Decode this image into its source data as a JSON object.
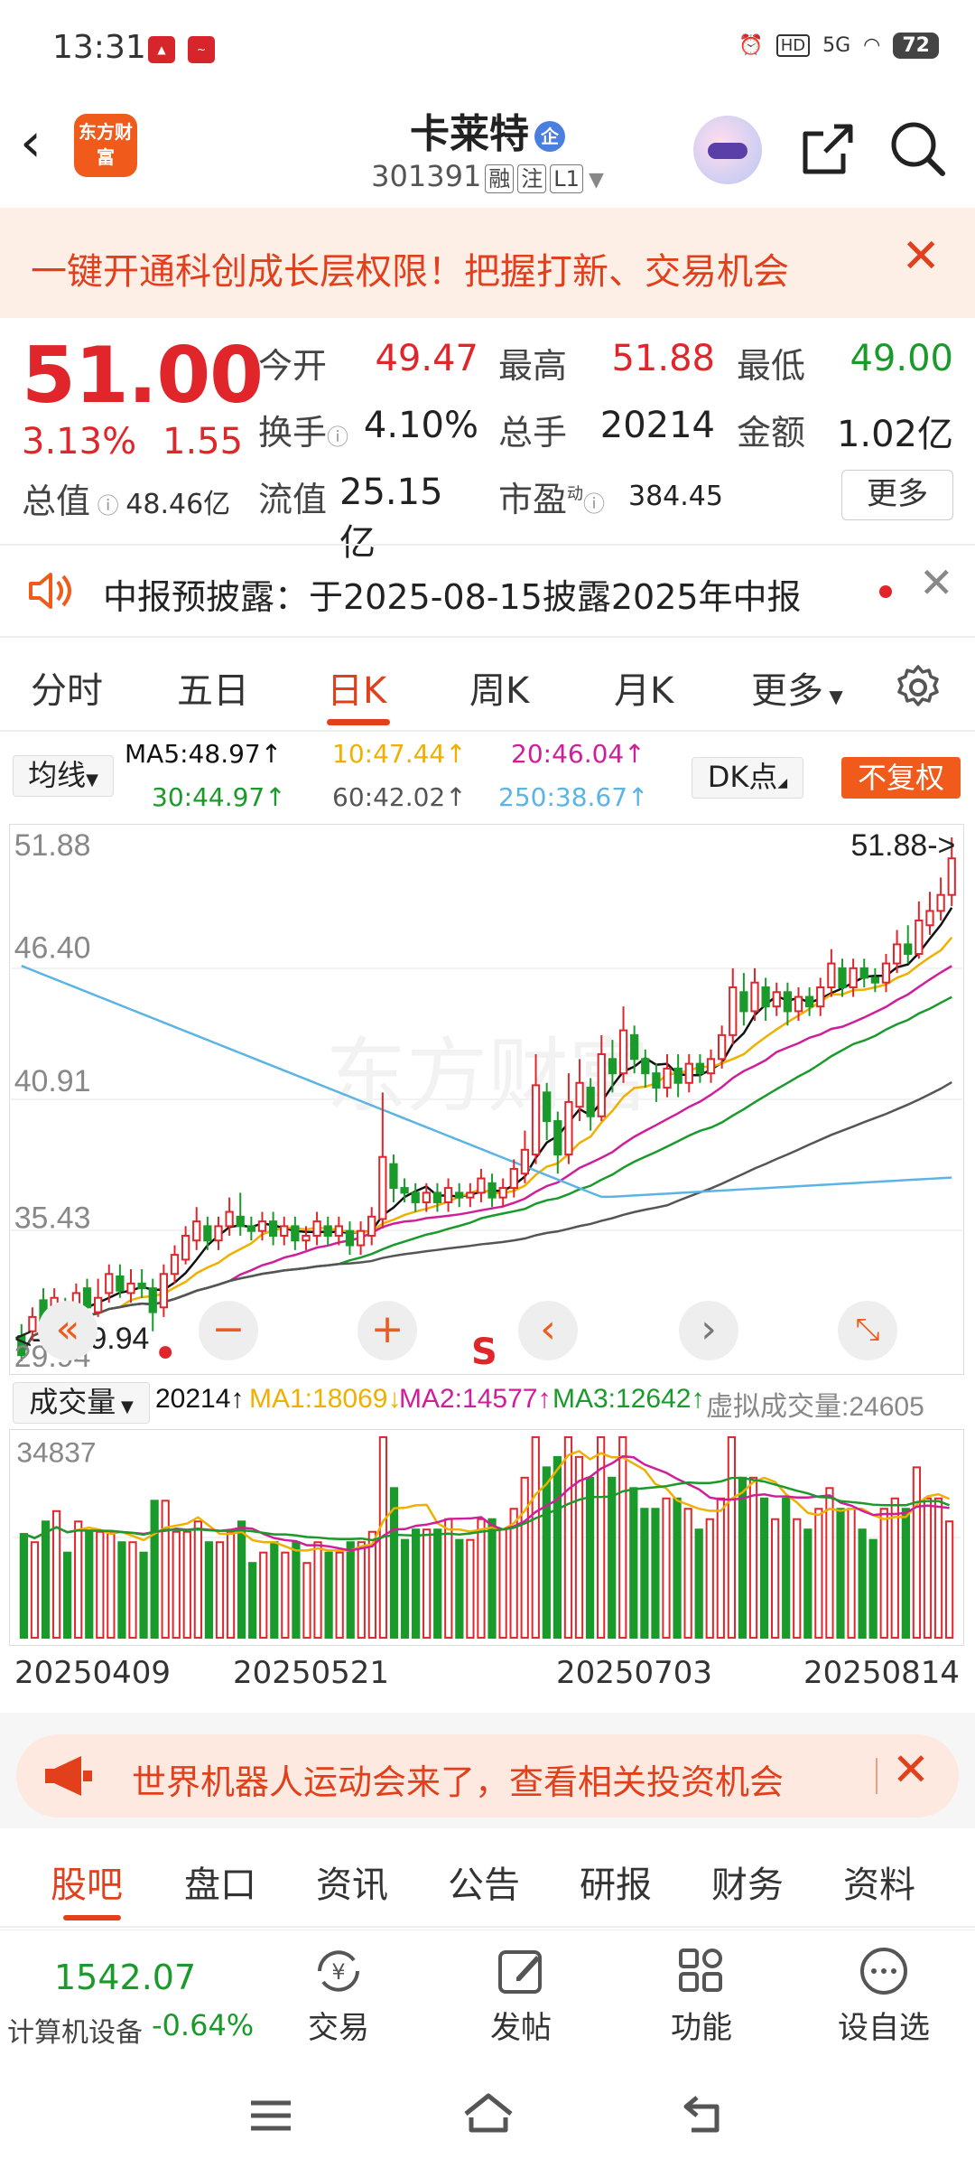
{
  "status": {
    "time": "13:31",
    "network": "5G",
    "battery": "72"
  },
  "header": {
    "stock_name": "卡莱特",
    "zheng_badge": "企",
    "code": "301391",
    "tags": [
      "融",
      "注",
      "L1"
    ],
    "logo_text": "东方财富"
  },
  "banner_top": {
    "text": "一键开通科创成长层权限！把握打新、交易机会",
    "close": "✕"
  },
  "quote": {
    "price": "51.00",
    "change_pct": "3.13%",
    "change": "1.55",
    "total_value_label": "总值",
    "total_value": "48.46亿",
    "open_label": "今开",
    "open": "49.47",
    "high_label": "最高",
    "high": "51.88",
    "low_label": "最低",
    "low": "49.00",
    "turnover_label": "换手",
    "turnover": "4.10%",
    "volume_label": "总手",
    "volume": "20214",
    "amount_label": "金额",
    "amount": "1.02亿",
    "float_label": "流值",
    "float_value": "25.15亿",
    "pe_label": "市盈",
    "pe_sup": "动",
    "pe": "384.45",
    "more": "更多"
  },
  "notice": {
    "text": "中报预披露：于2025-08-15披露2025年中报"
  },
  "tabs": [
    "分时",
    "五日",
    "日K",
    "周K",
    "月K",
    "更多"
  ],
  "active_tab": "日K",
  "ma_bar": {
    "selector": "均线",
    "dk": "DK点",
    "fuquan": "不复权",
    "ma5": "MA5:48.97↑",
    "ma10": "10:47.44↑",
    "ma20": "20:46.04↑",
    "ma30": "30:44.97↑",
    "ma60": "60:42.02↑",
    "ma250": "250:38.67↑"
  },
  "colors": {
    "up": "#e0252b",
    "down": "#1a9a2a",
    "accent": "#e2401c",
    "ma5": "#111111",
    "ma10": "#f0b000",
    "ma20": "#d01e9a",
    "ma30": "#1a9a2a",
    "ma60": "#555555",
    "ma250": "#5ab4e6"
  },
  "kline_labels": {
    "y_top": "51.88",
    "y2": "46.40",
    "y3": "40.91",
    "y4": "35.43",
    "y_bottom": "29.94",
    "max_marker": "51.88->",
    "min_marker": "<----29.94",
    "s_badge": "S"
  },
  "volume_bar": {
    "selector": "成交量",
    "vol": "20214↑",
    "ma1": "MA1:18069↓",
    "ma2": "MA2:14577↑",
    "ma3": "MA3:12642↑",
    "virtual": "虚拟成交量:24605",
    "y_max": "34837"
  },
  "dates": [
    "20250409",
    "20250521",
    "20250703",
    "20250814"
  ],
  "chart_data": {
    "type": "candlestick",
    "ylim": [
      29.94,
      51.88
    ],
    "volume_max": 34837,
    "candles_approx": [
      [
        31.0,
        30.2,
        31.5,
        29.94
      ],
      [
        31.2,
        31.8,
        32.2,
        30.8
      ],
      [
        32.5,
        31.6,
        33.0,
        31.2
      ],
      [
        31.4,
        32.6,
        33.0,
        31.0
      ],
      [
        32.0,
        31.8,
        32.6,
        31.4
      ],
      [
        31.6,
        32.8,
        33.2,
        31.4
      ],
      [
        33.0,
        32.2,
        33.4,
        31.8
      ],
      [
        32.0,
        32.6,
        33.4,
        31.8
      ],
      [
        32.8,
        33.6,
        34.0,
        32.4
      ],
      [
        33.5,
        32.9,
        34.0,
        32.6
      ],
      [
        32.8,
        33.2,
        33.8,
        32.4
      ],
      [
        33.2,
        33.0,
        33.8,
        32.6
      ],
      [
        33.0,
        32.0,
        33.4,
        31.2
      ],
      [
        32.2,
        33.6,
        34.0,
        31.8
      ],
      [
        33.6,
        34.4,
        34.8,
        33.2
      ],
      [
        34.2,
        35.2,
        35.6,
        34.0
      ],
      [
        35.0,
        35.8,
        36.4,
        34.6
      ],
      [
        35.6,
        35.0,
        36.0,
        34.6
      ],
      [
        35.0,
        35.6,
        36.0,
        34.6
      ],
      [
        35.6,
        36.2,
        36.8,
        35.2
      ],
      [
        36.0,
        35.6,
        37.0,
        35.2
      ],
      [
        35.6,
        35.4,
        36.0,
        35.0
      ],
      [
        35.4,
        35.8,
        36.2,
        35.0
      ],
      [
        35.8,
        35.2,
        36.2,
        34.8
      ],
      [
        35.2,
        35.6,
        36.0,
        34.8
      ],
      [
        35.6,
        35.0,
        36.0,
        34.6
      ],
      [
        35.0,
        35.2,
        35.6,
        34.6
      ],
      [
        35.2,
        35.8,
        36.2,
        34.8
      ],
      [
        35.6,
        35.2,
        36.0,
        34.8
      ],
      [
        35.2,
        35.6,
        36.0,
        34.8
      ],
      [
        35.4,
        34.8,
        35.8,
        34.4
      ],
      [
        34.8,
        35.4,
        35.8,
        34.4
      ],
      [
        35.2,
        36.0,
        36.4,
        34.8
      ],
      [
        35.9,
        38.5,
        41.2,
        35.5
      ],
      [
        38.2,
        37.2,
        38.6,
        36.6
      ],
      [
        37.2,
        37.0,
        37.6,
        36.6
      ],
      [
        37.0,
        36.6,
        37.4,
        36.2
      ],
      [
        36.6,
        37.0,
        37.4,
        36.2
      ],
      [
        37.0,
        36.6,
        37.4,
        36.2
      ],
      [
        36.6,
        37.2,
        37.6,
        36.2
      ],
      [
        37.0,
        36.8,
        37.4,
        36.4
      ],
      [
        36.8,
        37.0,
        37.4,
        36.4
      ],
      [
        37.0,
        37.6,
        38.0,
        36.6
      ],
      [
        37.4,
        36.8,
        37.8,
        36.4
      ],
      [
        36.8,
        37.2,
        37.6,
        36.4
      ],
      [
        37.2,
        38.0,
        38.4,
        36.8
      ],
      [
        37.8,
        38.8,
        39.6,
        37.4
      ],
      [
        38.6,
        41.5,
        42.8,
        38.2
      ],
      [
        41.2,
        40.0,
        41.6,
        39.2
      ],
      [
        40.0,
        38.6,
        40.4,
        37.8
      ],
      [
        38.6,
        40.8,
        42.0,
        38.2
      ],
      [
        40.6,
        41.6,
        42.6,
        40.0
      ],
      [
        41.4,
        40.2,
        41.8,
        39.6
      ],
      [
        40.2,
        42.8,
        43.6,
        40.0
      ],
      [
        42.6,
        42.0,
        43.4,
        41.2
      ],
      [
        42.0,
        43.8,
        44.8,
        41.6
      ],
      [
        43.6,
        42.6,
        44.0,
        42.0
      ],
      [
        42.6,
        42.0,
        43.0,
        41.4
      ],
      [
        42.0,
        41.4,
        42.4,
        40.8
      ],
      [
        41.4,
        42.2,
        42.8,
        41.0
      ],
      [
        42.2,
        41.6,
        42.8,
        41.0
      ],
      [
        41.6,
        42.4,
        42.8,
        41.2
      ],
      [
        42.4,
        42.0,
        42.8,
        41.6
      ],
      [
        42.0,
        42.6,
        43.0,
        41.6
      ],
      [
        42.6,
        43.6,
        44.0,
        42.2
      ],
      [
        43.6,
        45.6,
        46.4,
        43.2
      ],
      [
        45.4,
        44.6,
        46.2,
        44.0
      ],
      [
        44.6,
        45.8,
        46.4,
        44.2
      ],
      [
        45.6,
        44.8,
        46.0,
        44.2
      ],
      [
        44.8,
        45.4,
        45.8,
        44.4
      ],
      [
        45.4,
        44.6,
        45.8,
        44.0
      ],
      [
        44.6,
        45.2,
        45.6,
        44.2
      ],
      [
        45.2,
        44.8,
        45.6,
        44.4
      ],
      [
        44.8,
        45.6,
        46.0,
        44.4
      ],
      [
        45.6,
        46.6,
        47.2,
        45.2
      ],
      [
        46.4,
        45.6,
        46.8,
        45.2
      ],
      [
        45.6,
        46.4,
        46.8,
        45.2
      ],
      [
        46.4,
        46.0,
        46.8,
        45.6
      ],
      [
        46.0,
        45.8,
        46.4,
        45.4
      ],
      [
        45.8,
        46.6,
        47.0,
        45.4
      ],
      [
        46.6,
        47.4,
        48.0,
        46.2
      ],
      [
        47.4,
        47.0,
        48.2,
        46.6
      ],
      [
        47.0,
        48.4,
        49.2,
        46.8
      ],
      [
        48.2,
        48.8,
        49.6,
        47.8
      ],
      [
        48.8,
        49.47,
        50.2,
        48.4
      ],
      [
        49.47,
        51.0,
        51.88,
        49.0
      ]
    ]
  },
  "banner_bottom": {
    "text": "世界机器人运动会来了，查看相关投资机会",
    "close": "✕"
  },
  "sub_tabs": [
    "股吧",
    "盘口",
    "资讯",
    "公告",
    "研报",
    "财务",
    "资料"
  ],
  "bottom_bar": {
    "index_value": "1542.07",
    "index_name": "计算机设备",
    "index_pct": "-0.64%",
    "items": [
      "交易",
      "发帖",
      "功能",
      "设自选"
    ]
  }
}
